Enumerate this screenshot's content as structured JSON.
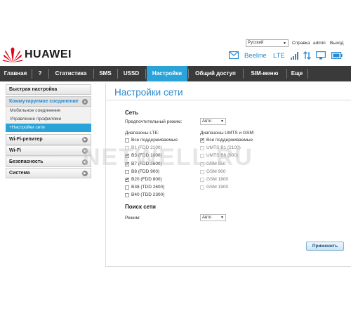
{
  "topbar": {
    "language": "Русский",
    "help": "Справка",
    "user": "admin",
    "logout": "Выход"
  },
  "brand": {
    "name": "HUAWEI"
  },
  "status": {
    "operator": "Beeline",
    "network_type": "LTE"
  },
  "nav": {
    "items": [
      "Главная",
      "?",
      "Статистика",
      "SMS",
      "USSD",
      "Настройки",
      "Общий доступ",
      "SIM-меню",
      "Еще"
    ],
    "active": "Настройки"
  },
  "sidebar": {
    "quick": "Быстрая настройка",
    "dial": "Коммутируемое соединение",
    "mobile": "Мобильное соединение",
    "profiles": "Управление профилями",
    "network": "+Настройки сети",
    "repeater": "Wi-Fi-репитер",
    "wifi": "Wi-Fi",
    "security": "Безопасность",
    "system": "Система"
  },
  "page": {
    "title": "Настройки сети",
    "network_section": "Сеть",
    "preferred_label": "Предпочтительный режим:",
    "preferred_value": "Авто",
    "lte_label": "Диапазоны LTE:",
    "umts_label": "Диапазоны UMTS и GSM:",
    "lte_bands": [
      {
        "label": "Все поддерживаемые",
        "checked": false,
        "disabled": false
      },
      {
        "label": "B1 (FDD 2100)",
        "checked": false,
        "disabled": true
      },
      {
        "label": "B3 (FDD 1800)",
        "checked": true,
        "disabled": false
      },
      {
        "label": "B7 (FDD 2600)",
        "checked": true,
        "disabled": false
      },
      {
        "label": "B8 (FDD 900)",
        "checked": false,
        "disabled": false
      },
      {
        "label": "B20 (FDD 800)",
        "checked": true,
        "disabled": false
      },
      {
        "label": "B38 (TDD 2600)",
        "checked": false,
        "disabled": false
      },
      {
        "label": "B40 (TDD 2300)",
        "checked": false,
        "disabled": false
      }
    ],
    "umts_bands": [
      {
        "label": "Все поддерживаемые",
        "checked": true,
        "disabled": false
      },
      {
        "label": "UMTS B1 (2100)",
        "checked": false,
        "disabled": true
      },
      {
        "label": "UMTS B8 (900)",
        "checked": false,
        "disabled": true
      },
      {
        "label": "GSM 850",
        "checked": false,
        "disabled": true
      },
      {
        "label": "GSM 900",
        "checked": false,
        "disabled": true
      },
      {
        "label": "GSM 1800",
        "checked": false,
        "disabled": true
      },
      {
        "label": "GSM 1900",
        "checked": false,
        "disabled": true
      }
    ],
    "search_section": "Поиск сети",
    "mode_label": "Режим:",
    "mode_value": "Авто",
    "apply": "Применить"
  },
  "watermark": "NETWELL.RU",
  "colors": {
    "accent": "#29a3d8",
    "nav_bg": "#3a3a3a",
    "brand_red": "#e60012",
    "title_blue": "#2a8ad0"
  },
  "icons": [
    "envelope-icon",
    "signal-icon",
    "data-arrows-icon",
    "monitor-icon",
    "battery-icon"
  ]
}
